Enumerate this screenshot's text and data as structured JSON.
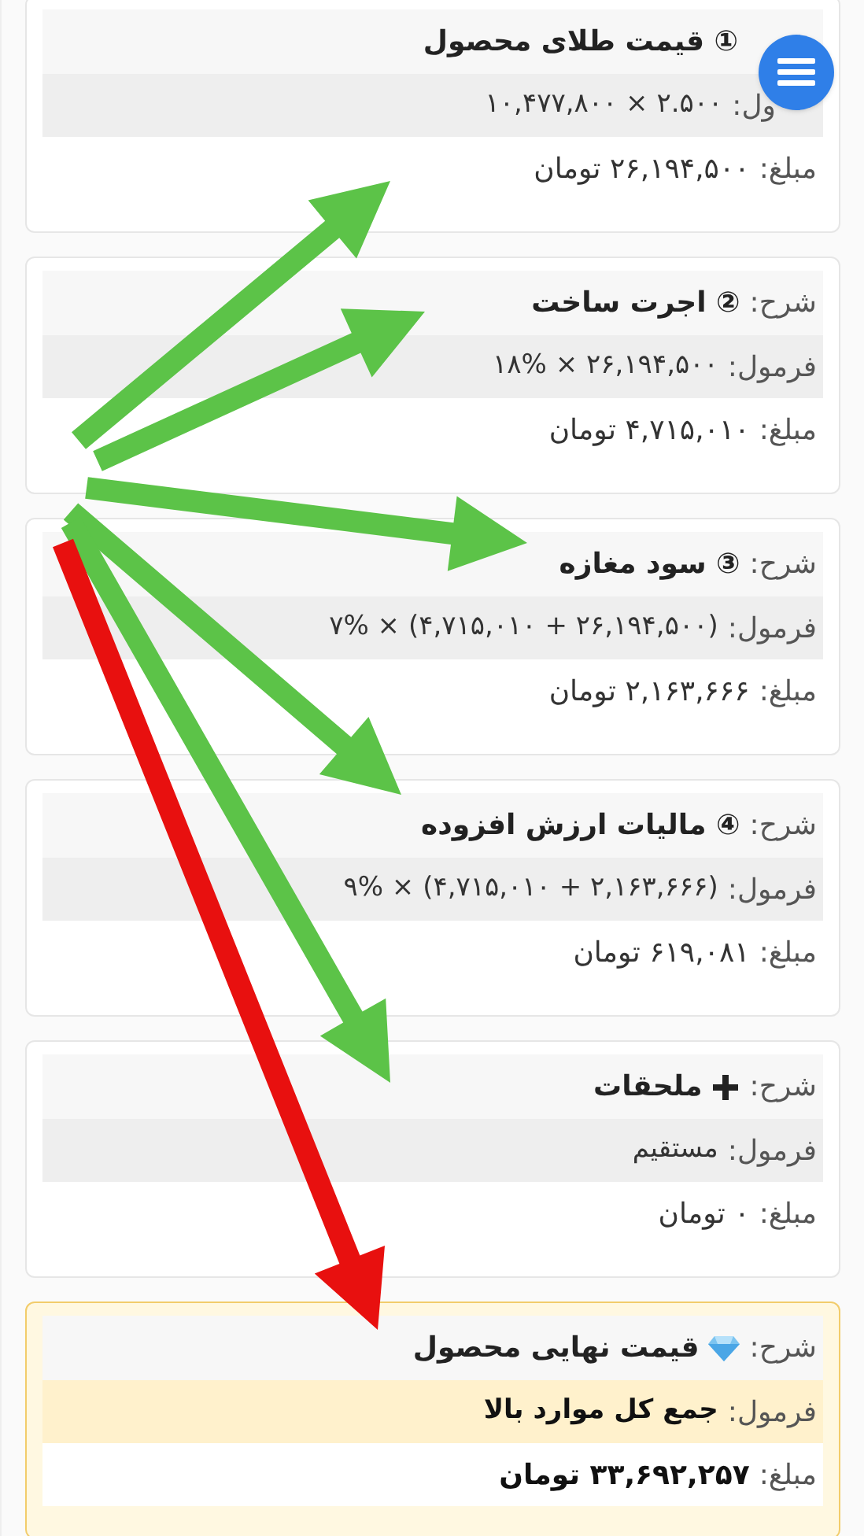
{
  "cards": [
    {
      "kind": "normal",
      "description": "① قیمت طلای محصول",
      "formula_label": "ول:",
      "formula": "۲.۵۰۰ × ۱۰,۴۷۷,۸۰۰",
      "amount_label": "مبلغ:",
      "amount": "۲۶,۱۹۴,۵۰۰ تومان"
    },
    {
      "kind": "normal",
      "description_label": "شرح:",
      "description": "② اجرت ساخت",
      "formula_label": "فرمول:",
      "formula": "۲۶,۱۹۴,۵۰۰ × ۱۸%",
      "amount_label": "مبلغ:",
      "amount": "۴,۷۱۵,۰۱۰ تومان"
    },
    {
      "kind": "normal",
      "description_label": "شرح:",
      "description": "③ سود مغازه",
      "formula_label": "فرمول:",
      "formula": "(۲۶,۱۹۴,۵۰۰ + ۴,۷۱۵,۰۱۰) × ۷%",
      "amount_label": "مبلغ:",
      "amount": "۲,۱۶۳,۶۶۶ تومان"
    },
    {
      "kind": "normal",
      "description_label": "شرح:",
      "description": "④ مالیات ارزش افزوده",
      "formula_label": "فرمول:",
      "formula": "(۲,۱۶۳,۶۶۶ + ۴,۷۱۵,۰۱۰) × ۹%",
      "amount_label": "مبلغ:",
      "amount": "۶۱۹,۰۸۱ تومان"
    },
    {
      "kind": "extra",
      "description_label": "شرح:",
      "description": "ملحقات",
      "formula_label": "فرمول:",
      "formula": "مستقیم",
      "amount_label": "مبلغ:",
      "amount": "۰ تومان"
    },
    {
      "kind": "total",
      "description_label": "شرح:",
      "description": "قیمت نهایی محصول",
      "formula_label": "فرمول:",
      "formula": "جمع کل موارد بالا",
      "amount_label": "مبلغ:",
      "amount": "۳۳,۶۹۲,۲۵۷ تومان"
    }
  ],
  "arrows": [
    {
      "color": "#5cc348"
    },
    {
      "color": "#5cc348"
    },
    {
      "color": "#5cc348"
    },
    {
      "color": "#5cc348"
    },
    {
      "color": "#5cc348"
    },
    {
      "color": "#e8100f"
    }
  ]
}
